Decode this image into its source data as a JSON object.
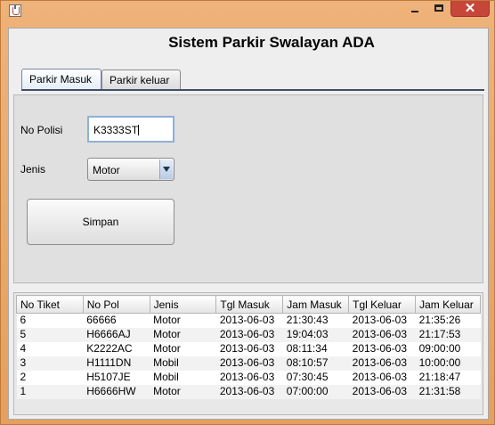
{
  "window": {
    "close_glyph": "✕"
  },
  "app": {
    "title": "Sistem Parkir Swalayan ADA"
  },
  "tabs": [
    {
      "label": "Parkir Masuk",
      "active": true
    },
    {
      "label": "Parkir keluar",
      "active": false
    }
  ],
  "form": {
    "no_polisi_label": "No Polisi",
    "no_polisi_value": "K3333ST",
    "jenis_label": "Jenis",
    "jenis_value": "Motor",
    "save_label": "Simpan"
  },
  "table": {
    "columns": [
      "No Tiket",
      "No Pol",
      "Jenis",
      "Tgl Masuk",
      "Jam Masuk",
      "Tgl Keluar",
      "Jam Keluar"
    ],
    "rows": [
      [
        "6",
        "66666",
        "Motor",
        "2013-06-03",
        "21:30:43",
        "2013-06-03",
        "21:35:26"
      ],
      [
        "5",
        "H6666AJ",
        "Motor",
        "2013-06-03",
        "19:04:03",
        "2013-06-03",
        "21:17:53"
      ],
      [
        "4",
        "K2222AC",
        "Motor",
        "2013-06-03",
        "08:11:34",
        "2013-06-03",
        "09:00:00"
      ],
      [
        "3",
        "H1111DN",
        "Mobil",
        "2013-06-03",
        "08:10:57",
        "2013-06-03",
        "10:00:00"
      ],
      [
        "2",
        "H5107JE",
        "Mobil",
        "2013-06-03",
        "07:30:45",
        "2013-06-03",
        "21:18:47"
      ],
      [
        "1",
        "H6666HW",
        "Motor",
        "2013-06-03",
        "07:00:00",
        "2013-06-03",
        "21:31:58"
      ]
    ]
  },
  "colors": {
    "window_frame": "#e8a76a",
    "close_button": "#c7463a",
    "tab_underline": "#3f4f66"
  }
}
